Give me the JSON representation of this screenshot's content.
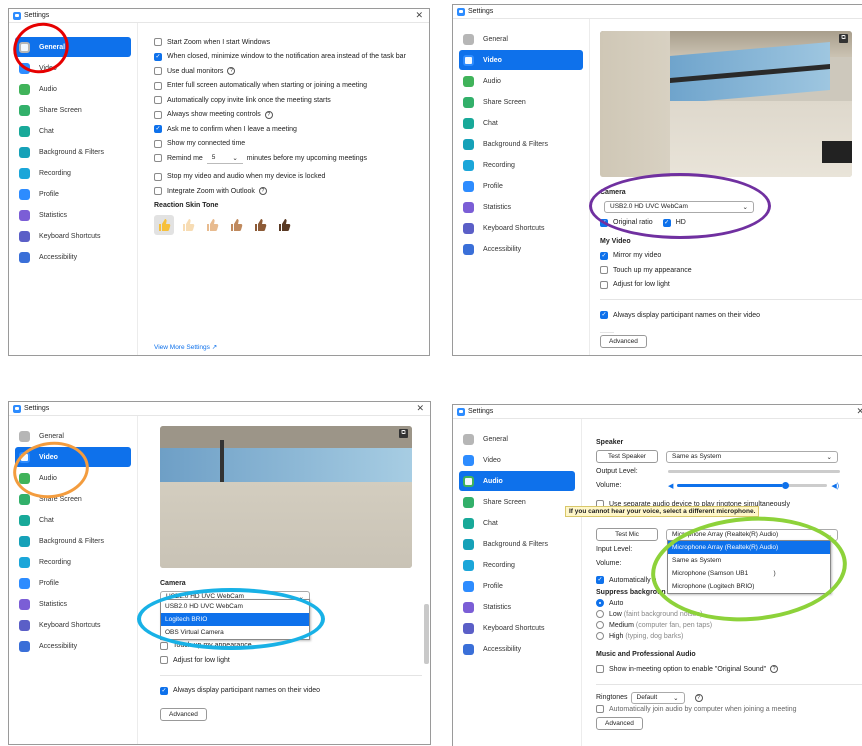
{
  "colors": {
    "accent": "#0e71eb",
    "red": "#e60000",
    "purple": "#7030a0",
    "orange": "#f39c3e",
    "blue": "#18b1e6",
    "green": "#8dd23a"
  },
  "window_title": "Settings",
  "close_glyph": "✕",
  "nav": [
    {
      "label": "General",
      "icon": "gear-icon",
      "color": "#b6b6b6"
    },
    {
      "label": "Video",
      "icon": "video-camera-icon",
      "color": "#2d8cff"
    },
    {
      "label": "Audio",
      "icon": "headphones-icon",
      "color": "#40b35a"
    },
    {
      "label": "Share Screen",
      "icon": "share-screen-icon",
      "color": "#32b06a"
    },
    {
      "label": "Chat",
      "icon": "chat-bubble-icon",
      "color": "#18a999"
    },
    {
      "label": "Background & Filters",
      "icon": "background-icon",
      "color": "#16a1b8"
    },
    {
      "label": "Recording",
      "icon": "recording-icon",
      "color": "#1ba6d9"
    },
    {
      "label": "Profile",
      "icon": "profile-icon",
      "color": "#2d8cff"
    },
    {
      "label": "Statistics",
      "icon": "statistics-icon",
      "color": "#7b5ed6"
    },
    {
      "label": "Keyboard Shortcuts",
      "icon": "keyboard-icon",
      "color": "#5b5fc7"
    },
    {
      "label": "Accessibility",
      "icon": "accessibility-icon",
      "color": "#3a6fd8"
    }
  ],
  "panel1": {
    "options": [
      {
        "label": "Start Zoom when I start Windows",
        "checked": false
      },
      {
        "label": "When closed, minimize window to the notification area instead of the task bar",
        "checked": true
      },
      {
        "label": "Use dual monitors",
        "checked": false,
        "help": "?"
      },
      {
        "label": "Enter full screen automatically when starting or joining a meeting",
        "checked": false
      },
      {
        "label": "Automatically copy invite link once the meeting starts",
        "checked": false
      },
      {
        "label": "Always show meeting controls",
        "checked": false,
        "help": "?"
      },
      {
        "label": "Ask me to confirm when I leave a meeting",
        "checked": true
      },
      {
        "label": "Show my connected time",
        "checked": false
      }
    ],
    "remind_label": "Remind me",
    "remind_value": "5",
    "remind_suffix": "minutes before my upcoming meetings",
    "stop_video": "Stop my video and audio when my device is locked",
    "integrate_outlook": "Integrate Zoom with Outlook",
    "skin_tone_title": "Reaction Skin Tone",
    "thumbs": [
      "#f6c03b",
      "#f7dcb4",
      "#e8bb8f",
      "#c08a5e",
      "#8c5a36",
      "#5a3a24"
    ],
    "view_more": "View More Settings"
  },
  "camera_title": "Camera",
  "camera_value": "USB2.0 HD UVC WebCam",
  "original_ratio": "Original ratio",
  "hd": "HD",
  "my_video": "My Video",
  "mirror": "Mirror my video",
  "touch_up": "Touch up my appearance",
  "low_light": "Adjust for low light",
  "always_display": "Always display participant names on their video",
  "advanced": "Advanced",
  "camera_options": [
    "USB2.0 HD UVC WebCam",
    "Logitech BRIO",
    "OBS Virtual Camera"
  ],
  "audio": {
    "speaker_title": "Speaker",
    "test_speaker": "Test Speaker",
    "speaker_value": "Same as System",
    "output_level": "Output Level:",
    "volume": "Volume:",
    "separate_device": "Use separate audio device to play ringtone simultaneously",
    "tooltip": "If you cannot hear your voice, select a different microphone.",
    "test_mic": "Test Mic",
    "mic_value": "Microphone Array (Realtek(R) Audio)",
    "input_level": "Input Level:",
    "automatically": "Automatically a",
    "suppress": "Suppress backgroun",
    "auto": "Auto",
    "low": "Low",
    "low_note": "(faint background noises)",
    "medium": "Medium",
    "medium_note": "(computer fan, pen taps)",
    "high": "High",
    "high_note": "(typing, dog barks)",
    "music_title": "Music and Professional Audio",
    "original_sound": "Show in-meeting option to enable \"Original Sound\"",
    "ringtones": "Ringtones",
    "ringtone_value": "Default",
    "auto_join": "Automatically join audio by computer when joining a meeting",
    "mic_options": [
      "Microphone Array (Realtek(R) Audio)",
      "Same as System",
      "Microphone (Samson UB1              )",
      "Microphone (Logitech BRIO)"
    ]
  }
}
